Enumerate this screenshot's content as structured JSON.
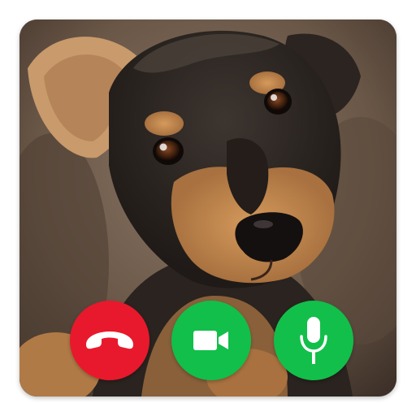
{
  "app_icon": {
    "subject": "puppy-photo",
    "buttons": [
      {
        "name": "decline-call",
        "icon": "phone-hangup-icon",
        "color": "#e8192c"
      },
      {
        "name": "video-call",
        "icon": "video-camera-icon",
        "color": "#12bf4a"
      },
      {
        "name": "voice-call",
        "icon": "microphone-icon",
        "color": "#12bf4a"
      }
    ]
  },
  "colors": {
    "decline": "#e8192c",
    "accept": "#12bf4a",
    "icon_glyph": "#ffffff"
  }
}
